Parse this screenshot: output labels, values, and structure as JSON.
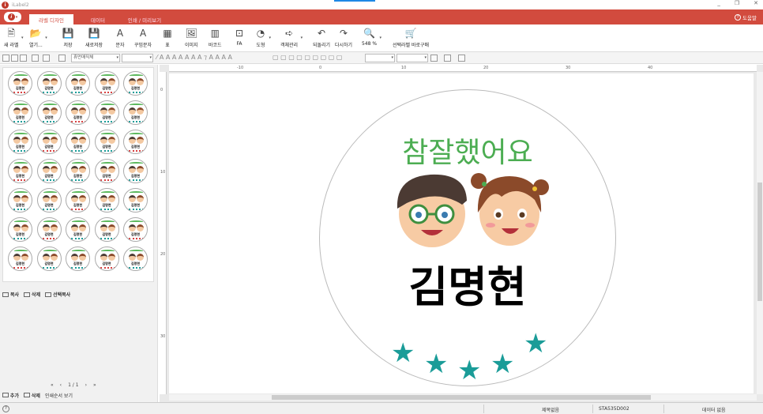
{
  "window": {
    "app_title": "iLabel2",
    "controls": [
      "_",
      "❐",
      "✕"
    ]
  },
  "tabs": [
    {
      "label": "라벨 디자인",
      "active": true
    },
    {
      "label": "데이터",
      "active": false
    },
    {
      "label": "인쇄 / 미리보기",
      "active": false
    }
  ],
  "help_label": "도움말",
  "ribbon": [
    {
      "id": "new-label",
      "label": "새 라벨",
      "icon": "🗎"
    },
    {
      "id": "open",
      "label": "열기...",
      "icon": "📂"
    },
    {
      "id": "save",
      "label": "저장",
      "icon": "💾"
    },
    {
      "id": "save-as",
      "label": "새로저장",
      "icon": "💾"
    },
    {
      "id": "text",
      "label": "문자",
      "icon": "A"
    },
    {
      "id": "wordart",
      "label": "꾸밈문자",
      "icon": "A"
    },
    {
      "id": "table",
      "label": "표",
      "icon": "▦"
    },
    {
      "id": "image",
      "label": "이미지",
      "icon": "🖼"
    },
    {
      "id": "barcode",
      "label": "바코드",
      "icon": "▥"
    },
    {
      "id": "fa",
      "label": "FA",
      "icon": "⊡"
    },
    {
      "id": "shape",
      "label": "도형",
      "icon": "◔"
    },
    {
      "id": "object-mgr",
      "label": "객체관리",
      "icon": "➪"
    },
    {
      "id": "undo",
      "label": "되돌리기",
      "icon": "↶"
    },
    {
      "id": "redo",
      "label": "다시하기",
      "icon": "↷"
    },
    {
      "id": "zoom",
      "label": "548 %",
      "icon": "🔍"
    },
    {
      "id": "buy",
      "label": "선택라벨 바로구매",
      "icon": "🛒"
    }
  ],
  "format": {
    "font_name": "휴먼매직체",
    "font_size": ""
  },
  "ruler": {
    "h_ticks": [
      "-10",
      "0",
      "10",
      "20",
      "30",
      "40"
    ],
    "v_ticks": [
      "0",
      "10",
      "20",
      "30"
    ]
  },
  "label": {
    "title_text": "참잘했어요",
    "name_text": "김명현",
    "star_count": 5,
    "star_color": "#1a9c98",
    "title_color": "#4cad52"
  },
  "thumbnails": {
    "rows": 7,
    "cols": 5,
    "name": "김명현"
  },
  "panel_actions": {
    "copy": "복사",
    "delete": "삭제",
    "select_copy": "선택복사"
  },
  "pager": {
    "first": "«",
    "prev": "‹",
    "page": "1 / 1",
    "next": "›",
    "last": "»"
  },
  "bottom_actions": {
    "add": "추가",
    "delete": "삭제",
    "print_order": "인쇄순서 보기"
  },
  "status": {
    "help": "?",
    "product_name": "제목없음",
    "product_code": "STA535D002",
    "data_state": "데이터 없음"
  }
}
